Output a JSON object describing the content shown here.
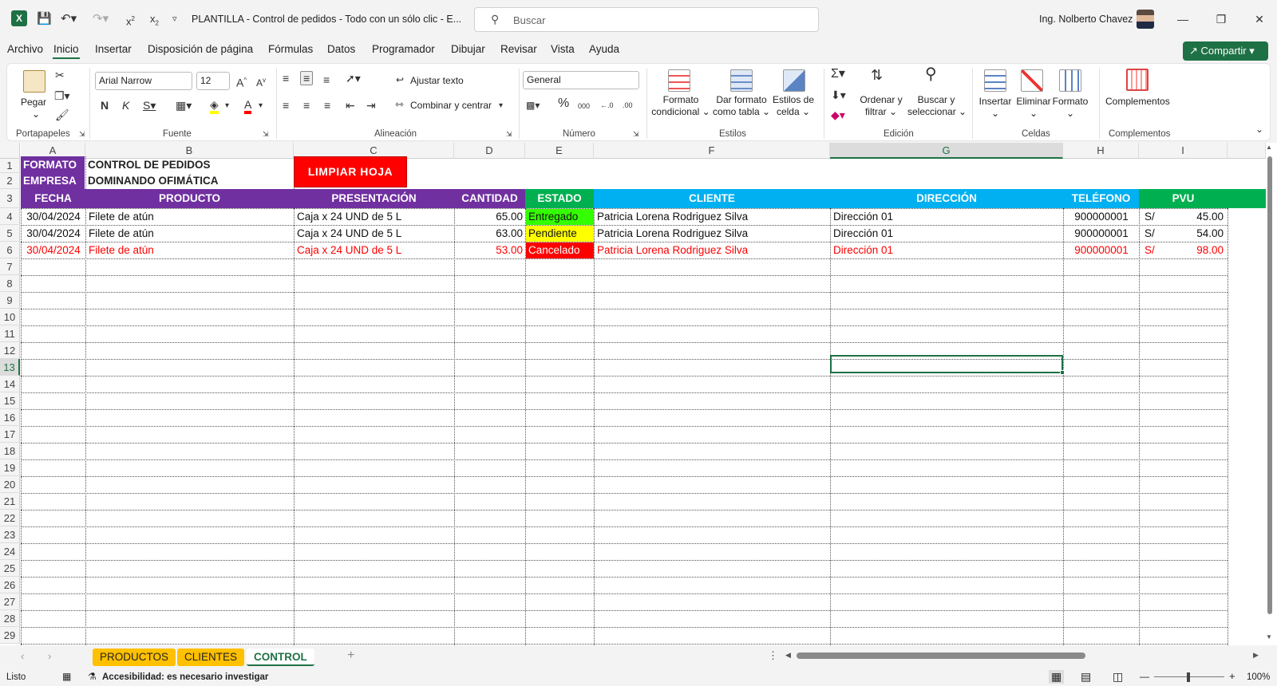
{
  "app": {
    "title": "PLANTILLA - Control de pedidos - Todo con un sólo clic  -  E...",
    "search_placeholder": "Buscar",
    "user": "Ing. Nolberto Chavez",
    "share_label": "Compartir"
  },
  "menu": [
    "Archivo",
    "Inicio",
    "Insertar",
    "Disposición de página",
    "Fórmulas",
    "Datos",
    "Programador",
    "Dibujar",
    "Revisar",
    "Vista",
    "Ayuda"
  ],
  "ribbon": {
    "paste": "Pegar",
    "font_name": "Arial Narrow",
    "font_size": "12",
    "wrap_text": "Ajustar texto",
    "merge_center": "Combinar y centrar",
    "number_format": "General",
    "cond_format": [
      "Formato",
      "condicional"
    ],
    "format_table": [
      "Dar formato",
      "como tabla"
    ],
    "cell_styles": [
      "Estilos de",
      "celda"
    ],
    "sort_filter": [
      "Ordenar y",
      "filtrar"
    ],
    "find_select": [
      "Buscar y",
      "seleccionar"
    ],
    "insert": "Insertar",
    "delete": "Eliminar",
    "format": "Formato",
    "addins": "Complementos",
    "groups": [
      "Portapapeles",
      "Fuente",
      "Alineación",
      "Número",
      "Estilos",
      "Edición",
      "Celdas",
      "Complementos"
    ]
  },
  "sheet": {
    "columns": [
      "A",
      "B",
      "C",
      "D",
      "E",
      "F",
      "G",
      "H",
      "I"
    ],
    "rows": [
      "1",
      "2",
      "3",
      "4",
      "5",
      "6",
      "7",
      "8",
      "9",
      "10",
      "11",
      "12",
      "13",
      "14",
      "15",
      "16",
      "17",
      "18",
      "19",
      "20",
      "21",
      "22",
      "23",
      "24",
      "25",
      "26",
      "27",
      "28",
      "29"
    ],
    "a1": "FORMATO",
    "b1": "CONTROL DE PEDIDOS",
    "a2": "EMPRESA",
    "b2": "DOMINANDO OFIMÁTICA",
    "clear_button": "LIMPIAR HOJA",
    "headers": [
      "FECHA",
      "PRODUCTO",
      "PRESENTACIÓN",
      "CANTIDAD",
      "ESTADO",
      "CLIENTE",
      "DIRECCIÓN",
      "TELÉFONO",
      "PVU"
    ],
    "data": [
      {
        "fecha": "30/04/2024",
        "producto": "Filete de atún",
        "presentacion": "Caja x 24 UND de 5 L",
        "cantidad": "65.00",
        "estado": "Entregado",
        "cliente": "Patricia Lorena Rodriguez Silva",
        "direccion": "Dirección 01",
        "telefono": "900000001",
        "moneda": "S/",
        "pvu": "45.00"
      },
      {
        "fecha": "30/04/2024",
        "producto": "Filete de atún",
        "presentacion": "Caja x 24 UND de 5 L",
        "cantidad": "63.00",
        "estado": "Pendiente",
        "cliente": "Patricia Lorena Rodriguez Silva",
        "direccion": "Dirección 01",
        "telefono": "900000001",
        "moneda": "S/",
        "pvu": "54.00"
      },
      {
        "fecha": "30/04/2024",
        "producto": "Filete de atún",
        "presentacion": "Caja x 24 UND de 5 L",
        "cantidad": "53.00",
        "estado": "Cancelado",
        "cliente": "Patricia Lorena Rodriguez Silva",
        "direccion": "Dirección 01",
        "telefono": "900000001",
        "moneda": "S/",
        "pvu": "98.00"
      }
    ]
  },
  "tabs": [
    "PRODUCTOS",
    "CLIENTES",
    "CONTROL"
  ],
  "status": {
    "ready": "Listo",
    "accessibility": "Accesibilidad: es necesario investigar",
    "zoom": "100%"
  },
  "colors": {
    "excel_green": "#1e7145",
    "purple": "#7030a0",
    "blue": "#00b0f0",
    "green": "#00b050",
    "red": "#ff0000",
    "yellow": "#ffff00",
    "bright_green": "#33ff00",
    "tab_orange": "#ffc000"
  }
}
